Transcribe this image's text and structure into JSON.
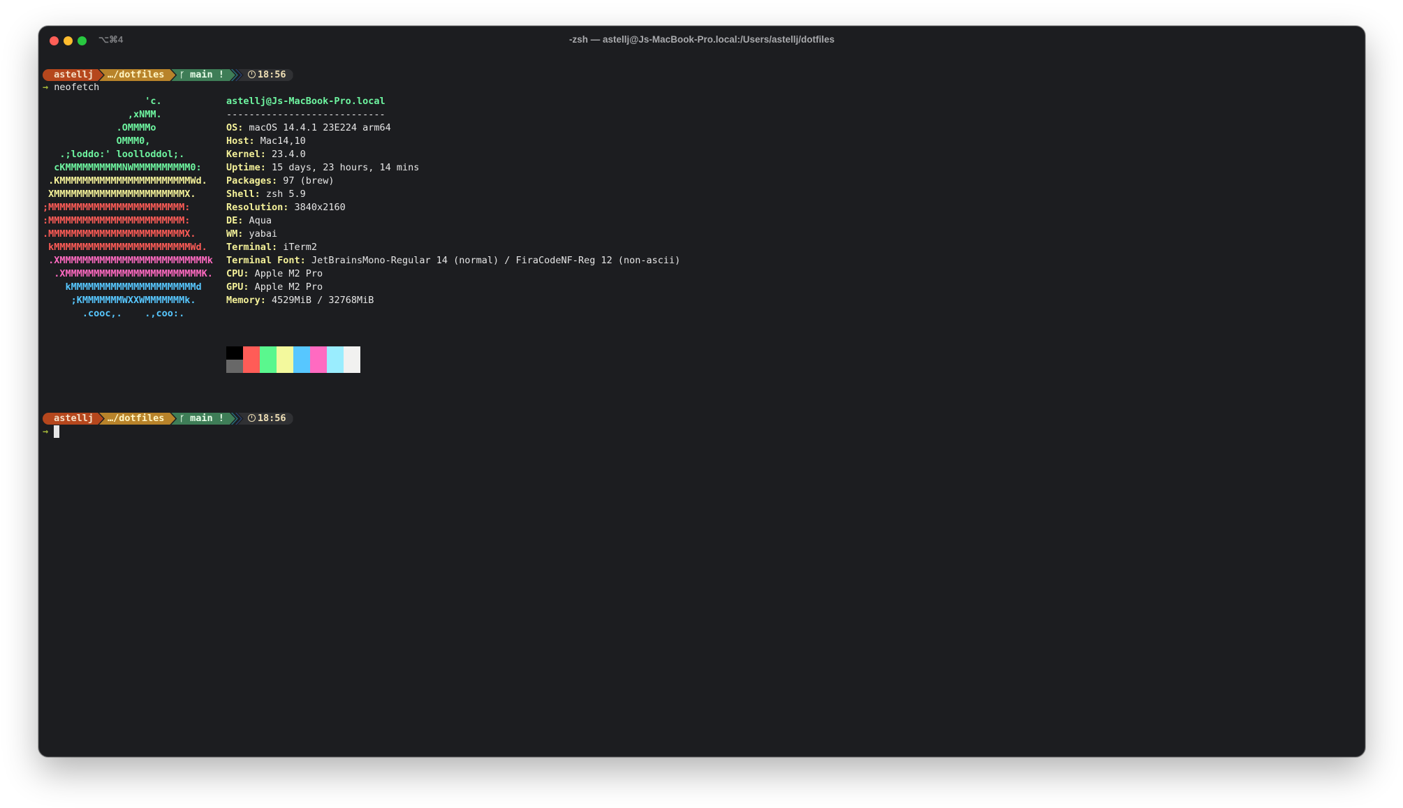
{
  "window": {
    "title": "-zsh — astellj@Js-MacBook-Pro.local:/Users/astellj/dotfiles",
    "tab_shortcut": "⌥⌘4"
  },
  "prompt": {
    "user": "astellj",
    "dir": "…/dotfiles",
    "branch": "main !",
    "time": "18:56",
    "arrow": "→"
  },
  "command": "neofetch",
  "ascii_art": [
    {
      "text": "                  'c.",
      "color": "#6ef5a0"
    },
    {
      "text": "               ,xNMM.",
      "color": "#6ef5a0"
    },
    {
      "text": "             .OMMMMo",
      "color": "#6ef5a0"
    },
    {
      "text": "             OMMM0,",
      "color": "#6ef5a0"
    },
    {
      "text": "   .;loddo:' loolloddol;.",
      "color": "#6ef5a0"
    },
    {
      "text": "  cKMMMMMMMMMMNWMMMMMMMMMM0:",
      "color": "#6ef5a0"
    },
    {
      "text": " .KMMMMMMMMMMMMMMMMMMMMMMMWd.",
      "color": "#f4f199"
    },
    {
      "text": " XMMMMMMMMMMMMMMMMMMMMMMMX.",
      "color": "#f4f199"
    },
    {
      "text": ";MMMMMMMMMMMMMMMMMMMMMMMM:",
      "color": "#ff5c57"
    },
    {
      "text": ":MMMMMMMMMMMMMMMMMMMMMMMM:",
      "color": "#ff5c57"
    },
    {
      "text": ".MMMMMMMMMMMMMMMMMMMMMMMMX.",
      "color": "#ff5c57"
    },
    {
      "text": " kMMMMMMMMMMMMMMMMMMMMMMMMWd.",
      "color": "#ff5c57"
    },
    {
      "text": " .XMMMMMMMMMMMMMMMMMMMMMMMMMMk",
      "color": "#ff6ac1"
    },
    {
      "text": "  .XMMMMMMMMMMMMMMMMMMMMMMMMK.",
      "color": "#ff6ac1"
    },
    {
      "text": "    kMMMMMMMMMMMMMMMMMMMMMMd",
      "color": "#57c7ff"
    },
    {
      "text": "     ;KMMMMMMMWXXWMMMMMMMk.",
      "color": "#57c7ff"
    },
    {
      "text": "       .cooc,.    .,coo:.",
      "color": "#57c7ff"
    }
  ],
  "info": {
    "header": "astellj@Js-MacBook-Pro.local",
    "dashes": "----------------------------",
    "rows": [
      {
        "key": "OS",
        "value": "macOS 14.4.1 23E224 arm64"
      },
      {
        "key": "Host",
        "value": "Mac14,10"
      },
      {
        "key": "Kernel",
        "value": "23.4.0"
      },
      {
        "key": "Uptime",
        "value": "15 days, 23 hours, 14 mins"
      },
      {
        "key": "Packages",
        "value": "97 (brew)"
      },
      {
        "key": "Shell",
        "value": "zsh 5.9"
      },
      {
        "key": "Resolution",
        "value": "3840x2160"
      },
      {
        "key": "DE",
        "value": "Aqua"
      },
      {
        "key": "WM",
        "value": "yabai"
      },
      {
        "key": "Terminal",
        "value": "iTerm2"
      },
      {
        "key": "Terminal Font",
        "value": "JetBrainsMono-Regular 14 (normal) / FiraCodeNF-Reg 12 (non-ascii)"
      },
      {
        "key": "CPU",
        "value": "Apple M2 Pro"
      },
      {
        "key": "GPU",
        "value": "Apple M2 Pro"
      },
      {
        "key": "Memory",
        "value": "4529MiB / 32768MiB"
      }
    ]
  },
  "palette": {
    "top": [
      "#000000",
      "#ff5c57",
      "#5af78e",
      "#f3f99d",
      "#57c7ff",
      "#ff6ac1",
      "#9aedfe",
      "#f1f1f0"
    ],
    "bottom": [
      "#686868",
      "#ff5c57",
      "#5af78e",
      "#f3f99d",
      "#57c7ff",
      "#ff6ac1",
      "#9aedfe",
      "#f1f1f0"
    ]
  }
}
